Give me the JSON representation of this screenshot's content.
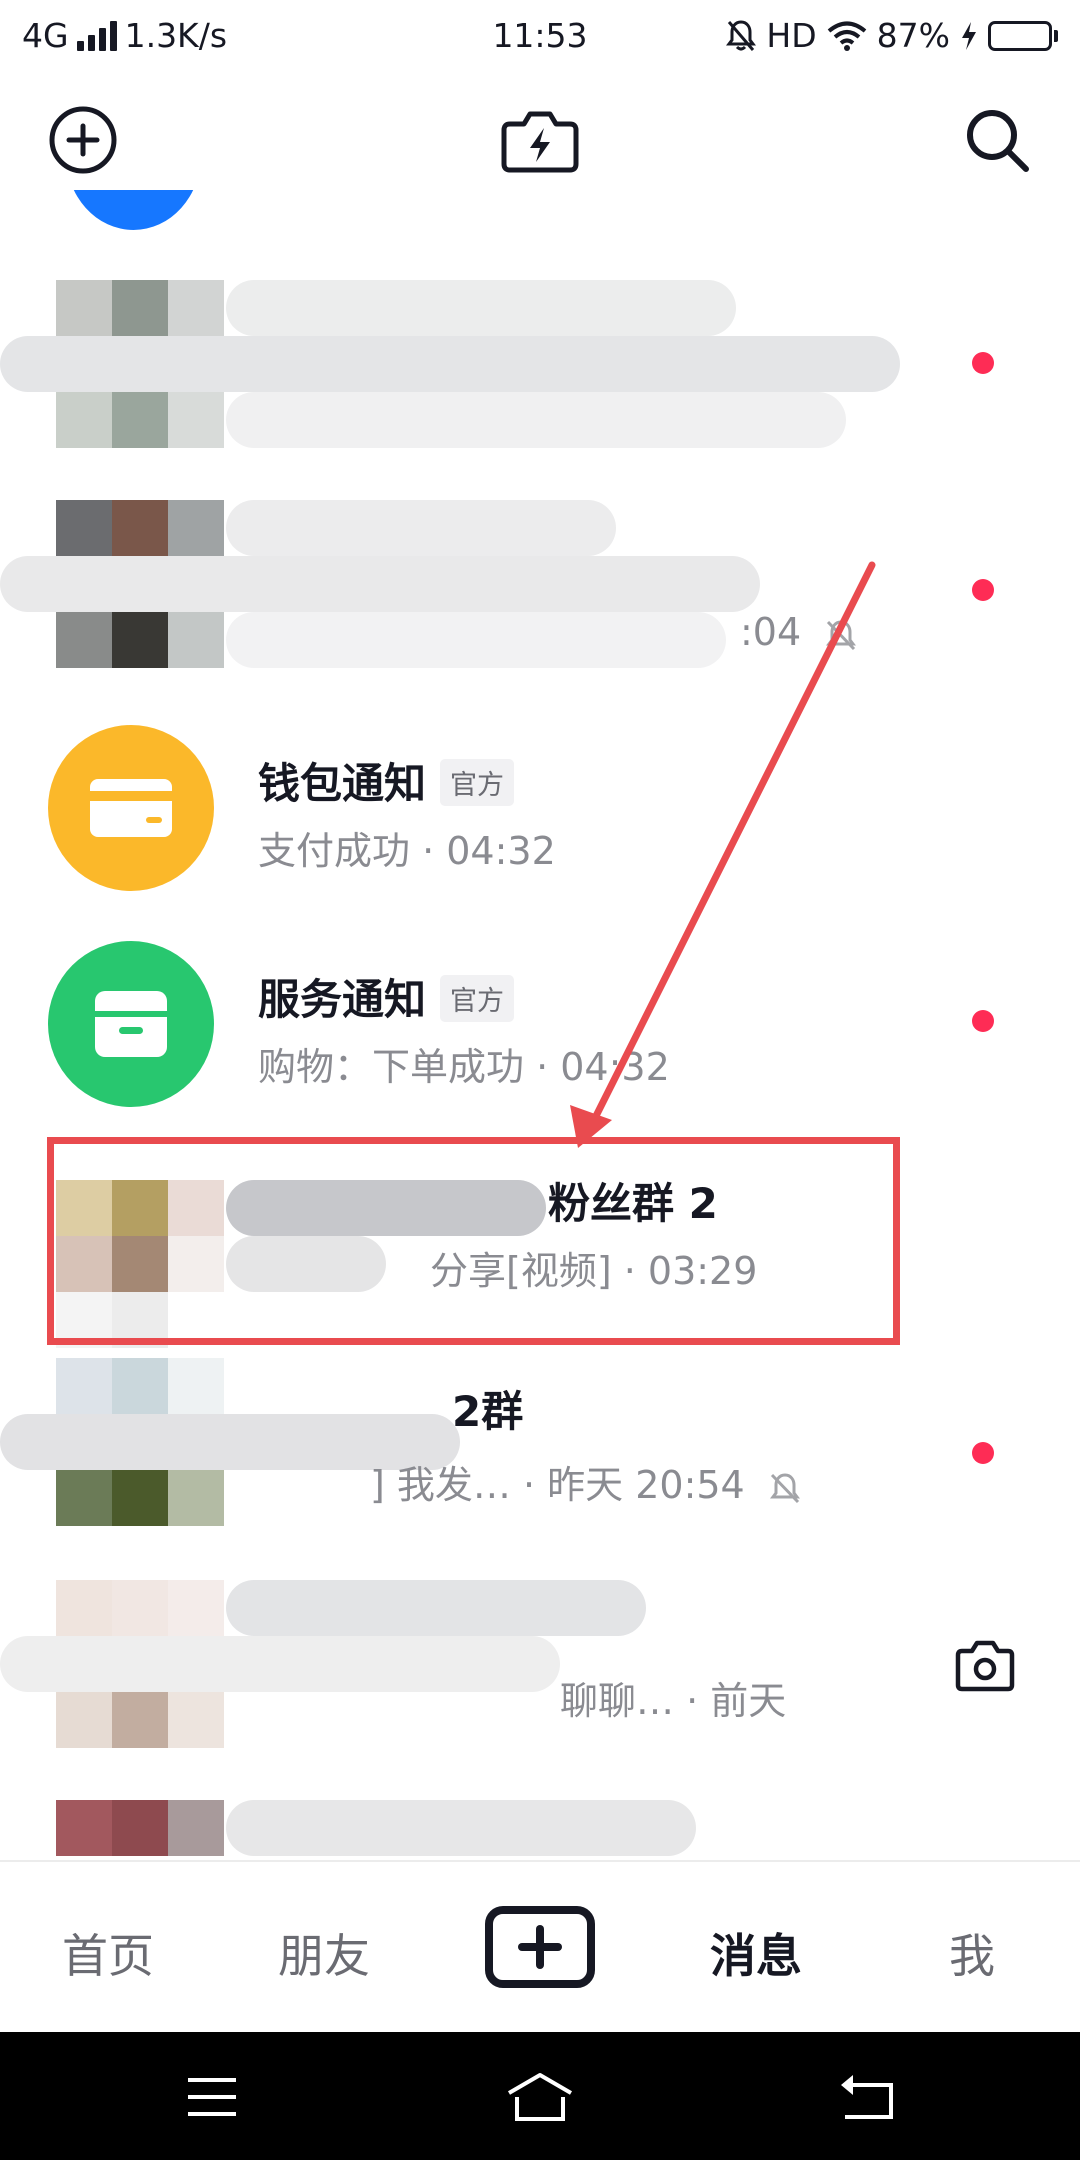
{
  "status_bar": {
    "network": "4G",
    "speed": "1.3K/s",
    "time": "11:53",
    "hd": "HD",
    "battery": "87%",
    "battery_level": 0.87
  },
  "top_bar": {
    "icons": [
      "add-circle-icon",
      "flash-camera-icon",
      "search-icon"
    ]
  },
  "conversations": [
    {
      "title": "",
      "subtitle": "",
      "unread_dot": true,
      "muted": true
    },
    {
      "title": "",
      "subtitle": ":04",
      "unread_dot": true,
      "muted": true
    },
    {
      "title": "钱包通知",
      "badge": "官方",
      "subtitle": "支付成功 · 04:32",
      "unread_dot": false,
      "icon": "wallet-card-icon",
      "avatar_color": "#fbb82a"
    },
    {
      "title": "服务通知",
      "badge": "官方",
      "subtitle": "购物：下单成功 · 04:32",
      "unread_dot": true,
      "icon": "inbox-box-icon",
      "avatar_color": "#28c76f"
    },
    {
      "title": "粉丝群 2",
      "subtitle": "分享[视频] · 03:29",
      "unread_dot": false,
      "highlighted": true
    },
    {
      "title": "2群",
      "subtitle": "] 我发… · 昨天 20:54",
      "unread_dot": true,
      "muted": true
    },
    {
      "title": "",
      "subtitle": "聊聊… · 前天",
      "unread_dot": false,
      "action_icon": "camera-icon"
    }
  ],
  "tab_bar": {
    "tabs": [
      "首页",
      "朋友",
      "消息",
      "我"
    ],
    "active": "消息"
  },
  "colors": {
    "unread": "#fe2c55",
    "highlight_annotation": "#e94b4f",
    "wallet": "#fbb82a",
    "service": "#28c76f"
  }
}
